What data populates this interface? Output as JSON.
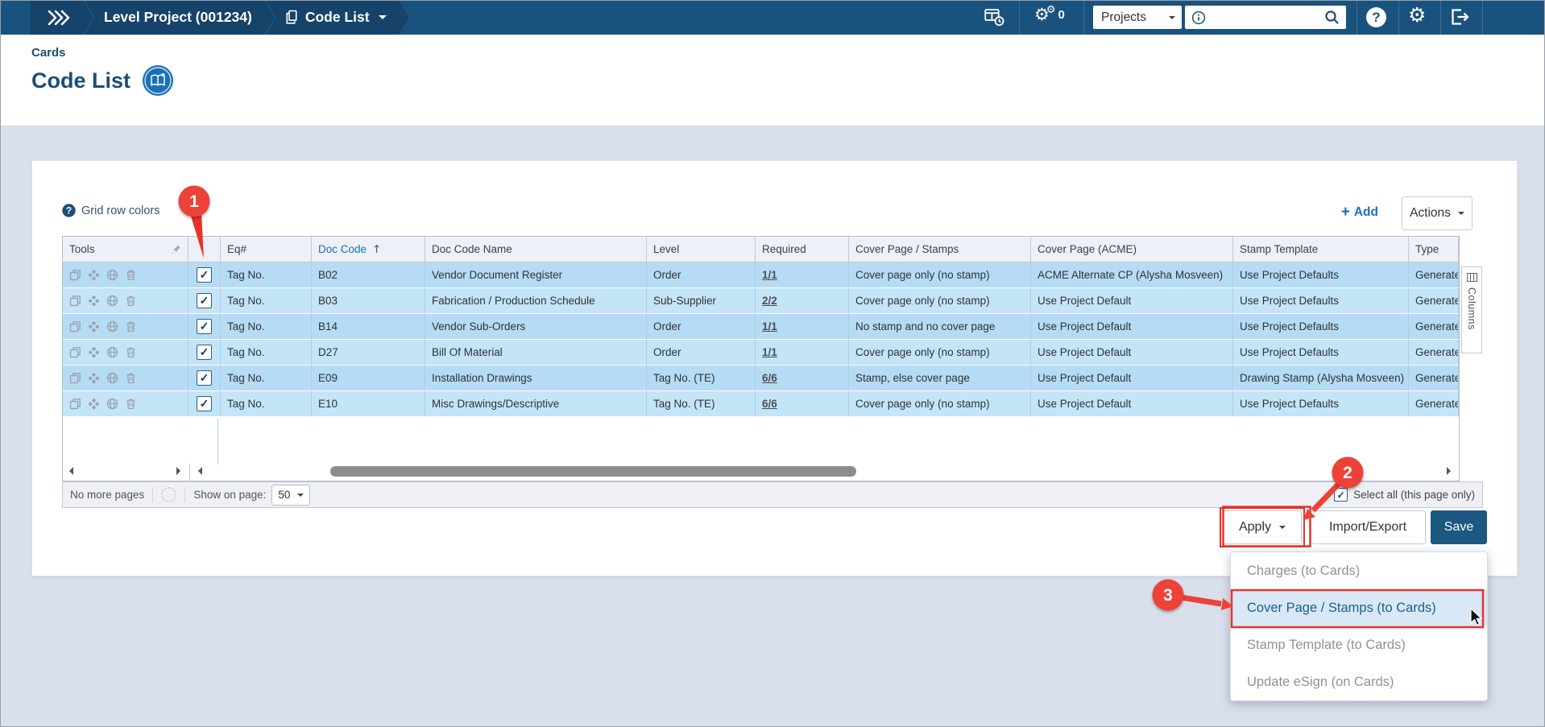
{
  "topbar": {
    "breadcrumb": {
      "project": "Level Project (001234)",
      "page": "Code List"
    },
    "notifications_count": "0",
    "scope_select": "Projects",
    "search_value": ""
  },
  "header": {
    "eyebrow": "Cards",
    "title": "Code List"
  },
  "toolbar": {
    "grid_row_colors_label": "Grid row colors",
    "add_label": "Add",
    "actions_label": "Actions"
  },
  "grid": {
    "columns": [
      "Tools",
      "",
      "Eq#",
      "Doc Code",
      "Doc Code Name",
      "Level",
      "Required",
      "Cover Page / Stamps",
      "Cover Page (ACME)",
      "Stamp Template",
      "Type"
    ],
    "sort": {
      "column": "Doc Code",
      "direction": "asc"
    },
    "columns_tab_label": "Columns",
    "rows": [
      {
        "checked": true,
        "eq": "Tag No.",
        "doc_code": "B02",
        "name": "Vendor Document Register",
        "level": "Order",
        "required": "1/1",
        "cover": "Cover page only (no stamp)",
        "cover_acme": "ACME Alternate CP (Alysha Mosveen)",
        "stamp": "Use Project Defaults",
        "type": "Generated"
      },
      {
        "checked": true,
        "eq": "Tag No.",
        "doc_code": "B03",
        "name": "Fabrication / Production Schedule",
        "level": "Sub-Supplier",
        "required": "2/2",
        "cover": "Cover page only (no stamp)",
        "cover_acme": "Use Project Default",
        "stamp": "Use Project Defaults",
        "type": "Generated"
      },
      {
        "checked": true,
        "eq": "Tag No.",
        "doc_code": "B14",
        "name": "Vendor Sub-Orders",
        "level": "Order",
        "required": "1/1",
        "cover": "No stamp and no cover page",
        "cover_acme": "Use Project Default",
        "stamp": "Use Project Defaults",
        "type": "Generated"
      },
      {
        "checked": true,
        "eq": "Tag No.",
        "doc_code": "D27",
        "name": "Bill Of Material",
        "level": "Order",
        "required": "1/1",
        "cover": "Cover page only (no stamp)",
        "cover_acme": "Use Project Default",
        "stamp": "Use Project Defaults",
        "type": "Generated"
      },
      {
        "checked": true,
        "eq": "Tag No.",
        "doc_code": "E09",
        "name": "Installation Drawings",
        "level": "Tag No. (TE)",
        "required": "6/6",
        "cover": "Stamp, else cover page",
        "cover_acme": "Use Project Default",
        "stamp": "Drawing Stamp (Alysha Mosveen)",
        "type": "Generated"
      },
      {
        "checked": true,
        "eq": "Tag No.",
        "doc_code": "E10",
        "name": "Misc Drawings/Descriptive",
        "level": "Tag No. (TE)",
        "required": "6/6",
        "cover": "Cover page only (no stamp)",
        "cover_acme": "Use Project Default",
        "stamp": "Use Project Defaults",
        "type": "Generated"
      }
    ]
  },
  "pagination": {
    "status": "No more pages",
    "show_on_page_label": "Show on page:",
    "page_size": "50",
    "select_all_label": "Select all (this page only)",
    "select_all_checked": true
  },
  "actions_bar": {
    "apply_label": "Apply",
    "import_export_label": "Import/Export",
    "save_label": "Save"
  },
  "apply_menu": {
    "items": [
      "Charges (to Cards)",
      "Cover Page / Stamps (to Cards)",
      "Stamp Template (to Cards)",
      "Update eSign (on Cards)"
    ],
    "highlighted_index": 1
  },
  "annotations": {
    "step1": "1",
    "step2": "2",
    "step3": "3"
  },
  "colors": {
    "topbar_bg": "#1a527e",
    "breadcrumb_segment": "#15436a",
    "navy_title": "#1b4e74",
    "accent_blue": "#1a70b8",
    "row_odd": "#b6dbf4",
    "row_even": "#c4e4f8",
    "annotation_red": "#e8332a",
    "save_button_bg": "#1d5880",
    "page_bg": "#d9dfeb"
  }
}
